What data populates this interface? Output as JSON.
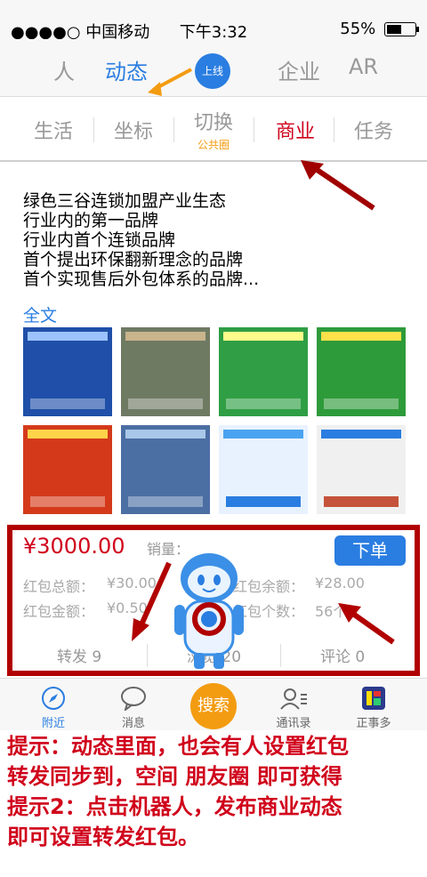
{
  "status_bar": {
    "carrier": "●●●●○ 中国移动",
    "time": "下午3:32",
    "battery": "55%"
  },
  "top_tabs": [
    "人",
    "动态",
    "企业",
    "AR"
  ],
  "online_badge": "上线",
  "sub_tabs": [
    "生活",
    "坐标",
    "切换",
    "商业",
    "任务"
  ],
  "sub_tab_caption": "公共圈",
  "post": {
    "lines": [
      "绿色三谷连锁加盟产业生态",
      "行业内的第一品牌",
      "行业内首个连锁品牌",
      "首个提出环保翻新理念的品牌",
      "首个实现售后外包体系的品牌..."
    ],
    "full_text_link": "全文"
  },
  "commerce": {
    "price": "¥3000.00",
    "sales_label": "销量：",
    "order_button": "下单",
    "info": [
      {
        "label": "红包总额：",
        "value": "¥30.00"
      },
      {
        "label": "红包余额：",
        "value": "¥28.00"
      },
      {
        "label": "红包金额：",
        "value": "¥0.50"
      },
      {
        "label": "红包个数：",
        "value": "56个"
      }
    ],
    "footer": {
      "forward": "转发 9",
      "views": "浏览 20",
      "comments": "评论  0"
    }
  },
  "bottom_nav": [
    {
      "label": "附近",
      "icon": "compass-icon"
    },
    {
      "label": "消息",
      "icon": "chat-bubble-icon"
    },
    {
      "label": "搜索",
      "icon": "search-icon"
    },
    {
      "label": "通讯录",
      "icon": "contacts-icon"
    },
    {
      "label": "正事多",
      "icon": "app-logo-icon"
    }
  ],
  "hints": [
    "提示：动态里面，也会有人设置红包",
    "转发同步到，空间 朋友圈 即可获得",
    "提示2：点击机器人，发布商业动态",
    "即可设置转发红包。"
  ],
  "colors": {
    "accent": "#2a7de1",
    "hint_red": "#d0021b",
    "search_orange": "#f39c12"
  }
}
